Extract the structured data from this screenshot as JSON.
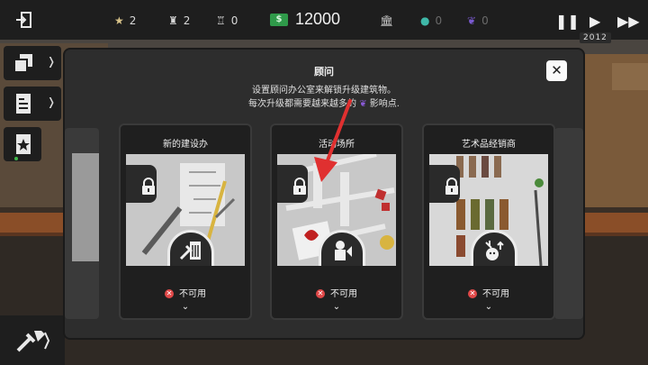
{
  "stats": {
    "stars": "2",
    "population": "2",
    "workers": "0",
    "money": "12000",
    "global": "0",
    "influence": "0"
  },
  "year": "2012",
  "modal": {
    "title": "顾问",
    "desc_line1": "设置顾问办公室来解锁升级建筑物。",
    "desc_line2_a": "每次升级都需要越来越多的",
    "desc_line2_b": "影响点."
  },
  "cards": [
    {
      "title": "新的建设办",
      "status": "不可用",
      "icon": "building-icon"
    },
    {
      "title": "活动场所",
      "status": "不可用",
      "icon": "event-icon"
    },
    {
      "title": "艺术品经销商",
      "status": "不可用",
      "icon": "art-icon"
    }
  ],
  "colors": {
    "money": "#2f9a4a",
    "global": "#3fb8a8",
    "influence": "#7a5ad0",
    "unavailable": "#e04848",
    "arrow": "#e03030"
  }
}
